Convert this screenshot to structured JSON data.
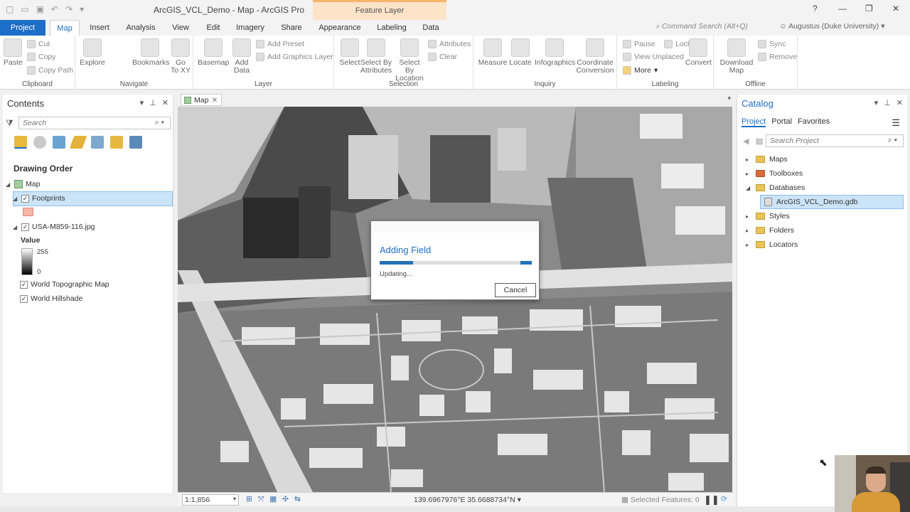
{
  "window": {
    "title": "ArcGIS_VCL_Demo - Map - ArcGIS Pro",
    "context_tab": "Feature Layer",
    "help": "?",
    "minimize": "—",
    "restore": "❐",
    "close": "✕"
  },
  "tabs": [
    "Project",
    "Map",
    "Insert",
    "Analysis",
    "View",
    "Edit",
    "Imagery",
    "Share",
    "Appearance",
    "Labeling",
    "Data"
  ],
  "command_search": "Command Search (Alt+Q)",
  "user": "Augustus (Duke University)",
  "ribbon": {
    "clipboard": {
      "label": "Clipboard",
      "paste": "Paste",
      "cut": "Cut",
      "copy": "Copy",
      "copy_path": "Copy Path"
    },
    "navigate": {
      "label": "Navigate",
      "explore": "Explore",
      "bookmarks": "Bookmarks",
      "goto_line1": "Go",
      "goto_line2": "To XY"
    },
    "layer": {
      "label": "Layer",
      "basemap": "Basemap",
      "add_data_line1": "Add",
      "add_data_line2": "Data",
      "add_preset": "Add Preset",
      "add_graphics": "Add Graphics Layer"
    },
    "selection": {
      "label": "Selection",
      "select": "Select",
      "select_by_attr_line1": "Select By",
      "select_by_attr_line2": "Attributes",
      "select_by_loc_line1": "Select By",
      "select_by_loc_line2": "Location",
      "attributes": "Attributes",
      "clear": "Clear"
    },
    "inquiry": {
      "label": "Inquiry",
      "measure": "Measure",
      "locate": "Locate",
      "infographics": "Infographics",
      "coord_line1": "Coordinate",
      "coord_line2": "Conversion"
    },
    "labeling": {
      "label": "Labeling",
      "pause": "Pause",
      "lock": "Lock",
      "view_unplaced": "View Unplaced",
      "more": "More",
      "convert": "Convert"
    },
    "offline": {
      "label": "Offline",
      "download_line1": "Download",
      "download_line2": "Map",
      "sync": "Sync",
      "remove": "Remove"
    }
  },
  "contents": {
    "title": "Contents",
    "search_placeholder": "Search",
    "drawing_order": "Drawing Order",
    "map": "Map",
    "footprints": "Footprints",
    "raster": "USA-M859-116.jpg",
    "value_label": "Value",
    "value_max": "255",
    "value_min": "0",
    "topo": "World Topographic Map",
    "hillshade": "World Hillshade"
  },
  "map_view": {
    "tab": "Map",
    "scale": "1:1,856",
    "coords": "139.6967976°E 35.6688734°N",
    "selected": "Selected Features: 0"
  },
  "dialog": {
    "title": "Adding Field",
    "status": "Updating...",
    "cancel": "Cancel",
    "progress_fraction": 0.22
  },
  "catalog": {
    "title": "Catalog",
    "tabs": [
      "Project",
      "Portal",
      "Favorites"
    ],
    "search_placeholder": "Search Project",
    "items": [
      "Maps",
      "Toolboxes",
      "Databases",
      "ArcGIS_VCL_Demo.gdb",
      "Styles",
      "Folders",
      "Locators"
    ]
  },
  "colors": {
    "accent": "#1d6ec8",
    "selection": "#cce4f7",
    "footprint_swatch": "#f7b6a8"
  }
}
